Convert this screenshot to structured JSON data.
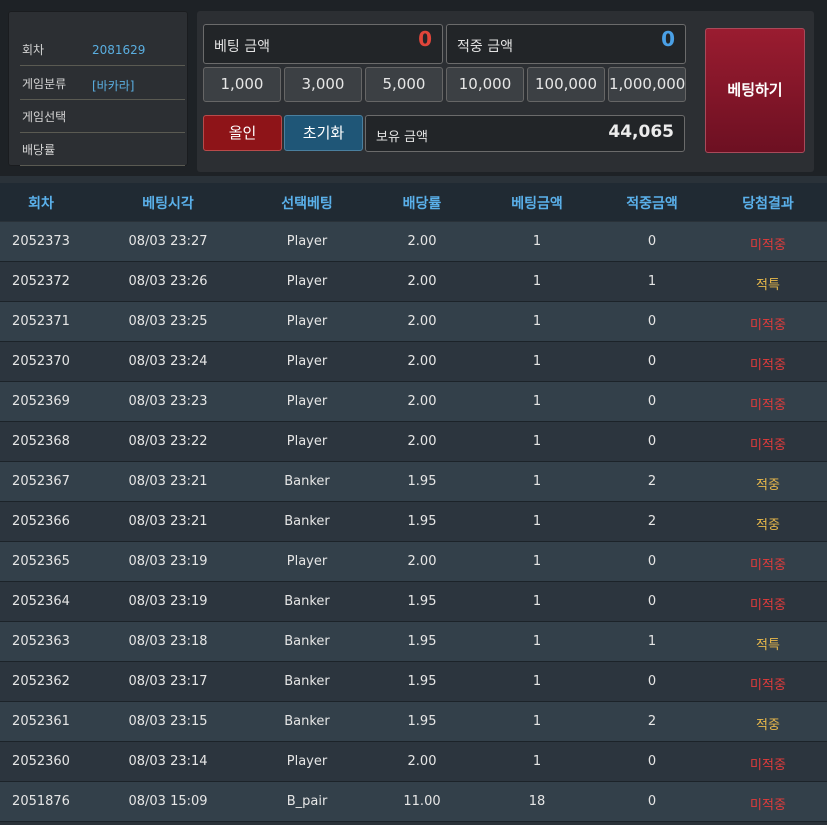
{
  "info": {
    "round_label": "회차",
    "round_value": "2081629",
    "game_type_label": "게임분류",
    "game_type_value": "[바카라]",
    "game_select_label": "게임선택",
    "odds_label": "배당률"
  },
  "bet_box": {
    "label": "베팅 금액",
    "value": "0"
  },
  "win_box": {
    "label": "적중 금액",
    "value": "0"
  },
  "chips": [
    "1,000",
    "3,000",
    "5,000",
    "10,000",
    "100,000",
    "1,000,000"
  ],
  "all_in_label": "올인",
  "reset_label": "초기화",
  "balance": {
    "label": "보유 금액",
    "value": "44,065"
  },
  "bet_button_label": "베팅하기",
  "colors": {
    "lose": "#e23b3b",
    "win": "#e8b84a",
    "header": "#5ab0ea",
    "bet_value": "#e0453a",
    "win_value": "#4aa0e6"
  },
  "table": {
    "headers": [
      "회차",
      "베팅시각",
      "선택베팅",
      "배당률",
      "베팅금액",
      "적중금액",
      "당첨결과"
    ],
    "rows": [
      [
        "2052373",
        "08/03 23:27",
        "Player",
        "2.00",
        "1",
        "0",
        "미적중"
      ],
      [
        "2052372",
        "08/03 23:26",
        "Player",
        "2.00",
        "1",
        "1",
        "적특"
      ],
      [
        "2052371",
        "08/03 23:25",
        "Player",
        "2.00",
        "1",
        "0",
        "미적중"
      ],
      [
        "2052370",
        "08/03 23:24",
        "Player",
        "2.00",
        "1",
        "0",
        "미적중"
      ],
      [
        "2052369",
        "08/03 23:23",
        "Player",
        "2.00",
        "1",
        "0",
        "미적중"
      ],
      [
        "2052368",
        "08/03 23:22",
        "Player",
        "2.00",
        "1",
        "0",
        "미적중"
      ],
      [
        "2052367",
        "08/03 23:21",
        "Banker",
        "1.95",
        "1",
        "2",
        "적중"
      ],
      [
        "2052366",
        "08/03 23:21",
        "Banker",
        "1.95",
        "1",
        "2",
        "적중"
      ],
      [
        "2052365",
        "08/03 23:19",
        "Player",
        "2.00",
        "1",
        "0",
        "미적중"
      ],
      [
        "2052364",
        "08/03 23:19",
        "Banker",
        "1.95",
        "1",
        "0",
        "미적중"
      ],
      [
        "2052363",
        "08/03 23:18",
        "Banker",
        "1.95",
        "1",
        "1",
        "적특"
      ],
      [
        "2052362",
        "08/03 23:17",
        "Banker",
        "1.95",
        "1",
        "0",
        "미적중"
      ],
      [
        "2052361",
        "08/03 23:15",
        "Banker",
        "1.95",
        "1",
        "2",
        "적중"
      ],
      [
        "2052360",
        "08/03 23:14",
        "Player",
        "2.00",
        "1",
        "0",
        "미적중"
      ],
      [
        "2051876",
        "08/03 15:09",
        "B_pair",
        "11.00",
        "18",
        "0",
        "미적중"
      ]
    ]
  }
}
